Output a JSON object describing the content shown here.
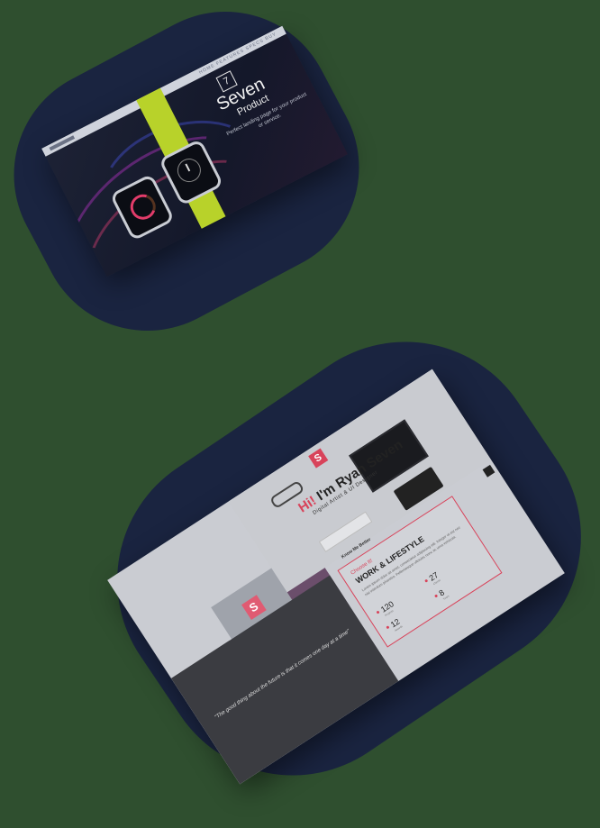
{
  "top_mockup": {
    "nav_menu": "HOME  FEATURES  SPECS  BUY",
    "logo_number": "7",
    "title": "Seven",
    "subtitle": "Product",
    "description": "Perfect landing page for your product or service."
  },
  "bottom_mockup": {
    "logo_letter": "S",
    "headline_hi": "Hi!",
    "headline_rest": " I'm Ryan Seven",
    "tagline": "Digital Artist & UI Designer",
    "know_label": "Know Me Better",
    "card": {
      "choose": "Choose It!",
      "title": "WORK & LIFESTYLE",
      "text": "Lorem ipsum dolor sit amet, consectetur adipiscing elit. Integer ut est nec nisi interdum pharetra. Pellentesque ultricies nunc ac urna vehicula."
    },
    "stats": [
      {
        "value": "120",
        "label": "Projects"
      },
      {
        "value": "27",
        "label": "Clients"
      },
      {
        "value": "12",
        "label": "Awards"
      },
      {
        "value": "8",
        "label": "Years"
      }
    ],
    "quote": "\"The good thing about the future is that it comes one day at a time\""
  },
  "colors": {
    "page_background": "#2f4f2f",
    "blob": "#1a2440",
    "accent_red": "#d8435a",
    "band_yellow": "#b8d22a"
  }
}
